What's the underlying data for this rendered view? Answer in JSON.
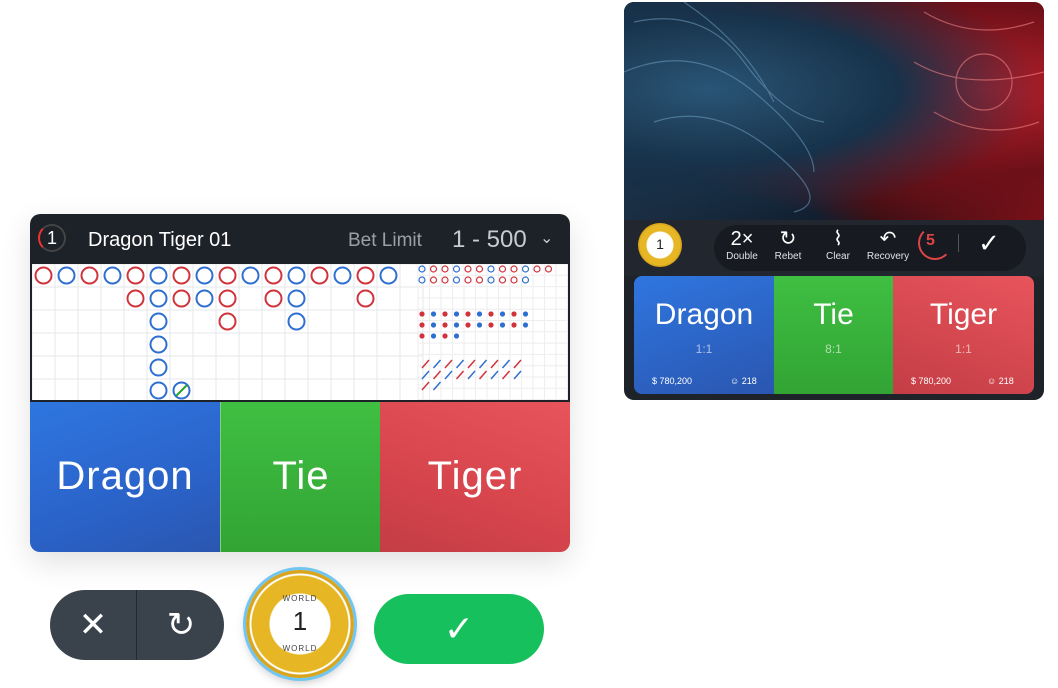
{
  "left_panel": {
    "round": "1",
    "table_name": "Dragon Tiger 01",
    "bet_limit_label": "Bet Limit",
    "bet_limit_value": "1 - 500",
    "bets": {
      "dragon": "Dragon",
      "tie": "Tie",
      "tiger": "Tiger"
    },
    "controls": {
      "clear_icon": "close-icon",
      "undo_icon": "undo-icon",
      "confirm_icon": "check-icon"
    },
    "chip": {
      "value": "1",
      "brand_top": "WORLD",
      "brand_bottom": "WORLD"
    }
  },
  "right_panel": {
    "chip_value": "1",
    "toolbar": {
      "double_icon": "2×",
      "double": "Double",
      "rebet": "Rebet",
      "clear": "Clear",
      "recovery": "Recovery",
      "counter": "5"
    },
    "bets": {
      "dragon": {
        "name": "Dragon",
        "ratio": "1:1",
        "amount": "780,200",
        "players": "218"
      },
      "tie": {
        "name": "Tie",
        "ratio": "8:1"
      },
      "tiger": {
        "name": "Tiger",
        "ratio": "1:1",
        "amount": "780,200",
        "players": "218"
      }
    }
  },
  "colors": {
    "dragon": "#2f76e0",
    "tie": "#3fbf42",
    "tiger": "#e8545c",
    "confirm": "#16c05c",
    "header_bg": "#1d2128"
  }
}
